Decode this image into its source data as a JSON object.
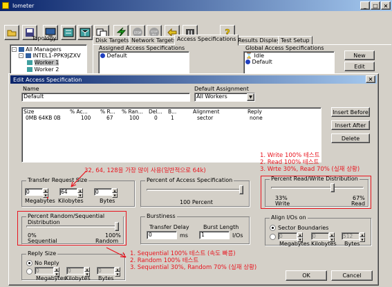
{
  "app": {
    "title": "Iometer"
  },
  "toolbar": [
    "open-icon",
    "save-icon",
    "config-icon",
    "new-worker-icon",
    "network-worker-icon",
    "start-icon",
    "stop-icon",
    "stop-all-icon",
    "reset-icon",
    "exit-icon",
    "help-icon"
  ],
  "topology": {
    "header": "Topology",
    "items": [
      "All Managers",
      "INTEL1-PPK9JZXV",
      "Worker 1",
      "Worker 2"
    ]
  },
  "tabs": [
    "Disk Targets",
    "Network Targets",
    "Access Specifications",
    "Results Display",
    "Test Setup"
  ],
  "assigned": {
    "title": "Assigned Access Specifications",
    "items": [
      "Default"
    ]
  },
  "global": {
    "title": "Global Access Specifications",
    "items": [
      "Idle",
      "Default"
    ],
    "new_label": "New",
    "edit_label": "Edit"
  },
  "dialog": {
    "title": "Edit Access Specification",
    "name_label": "Name",
    "name_value": "Default",
    "default_assignment_label": "Default Assignment",
    "default_assignment_value": "All Workers",
    "table": {
      "headers": [
        "Size",
        "% Ac...",
        "% R...",
        "% Ran...",
        "Del...",
        "B...",
        "Alignment",
        "Reply"
      ],
      "row": [
        "0MB  64KB  0B",
        "100",
        "67",
        "100",
        "0",
        "1",
        "sector",
        "none"
      ]
    },
    "buttons": {
      "insert_before": "Insert Before",
      "insert_after": "Insert After",
      "delete": "Delete",
      "ok": "OK",
      "cancel": "Cancel"
    },
    "transfer": {
      "title": "Transfer Request Size",
      "values": [
        "0",
        "64",
        "0"
      ],
      "labels": [
        "Megabytes",
        "Kilobytes",
        "Bytes"
      ]
    },
    "percent_access": {
      "title": "Percent of Access Specification",
      "value_label": "100 Percent",
      "percent": 100
    },
    "read_write": {
      "title": "Percent Read/Write Distribution",
      "left_pct": "33%",
      "left_name": "Write",
      "right_pct": "67%",
      "right_name": "Read",
      "read_percent": 67
    },
    "random_seq": {
      "title": "Percent Random/Sequential Distribution",
      "left_pct": "0%",
      "left_name": "Sequential",
      "right_pct": "100%",
      "right_name": "Random",
      "random_percent": 100
    },
    "burstiness": {
      "title": "Burstiness",
      "transfer_delay_label": "Transfer Delay",
      "transfer_delay_value": "0",
      "transfer_delay_unit": "ms",
      "burst_length_label": "Burst Length",
      "burst_length_value": "1",
      "burst_length_unit": "I/Os"
    },
    "align": {
      "title": "Align I/Os on",
      "option1": "Sector Boundaries",
      "values": [
        "0",
        "0",
        "512"
      ],
      "labels": [
        "Megabytes",
        "Kilobytes",
        "Bytes"
      ]
    },
    "reply": {
      "title": "Reply Size",
      "option1": "No Reply",
      "values": [
        "0",
        "0",
        "0"
      ],
      "labels": [
        "Megabytes",
        "Kilobytes",
        "Bytes"
      ]
    }
  },
  "annotations": {
    "transfer_note": "32, 64, 128을 가장 많이 사용(일반적으로 64k)",
    "rw_notes": [
      "1. Write 100% 테스트",
      "2. Read 100% 테스트",
      "3. Wrte 30%, Read 70% (실재 상황)"
    ],
    "rs_notes": [
      "1. Sequential 100% 테스트 (속도 빠름)",
      "2. Random 100% 테스트",
      "3. Sequential 30%, Random 70% (실재 상황)"
    ],
    "color": "#e8141e"
  }
}
